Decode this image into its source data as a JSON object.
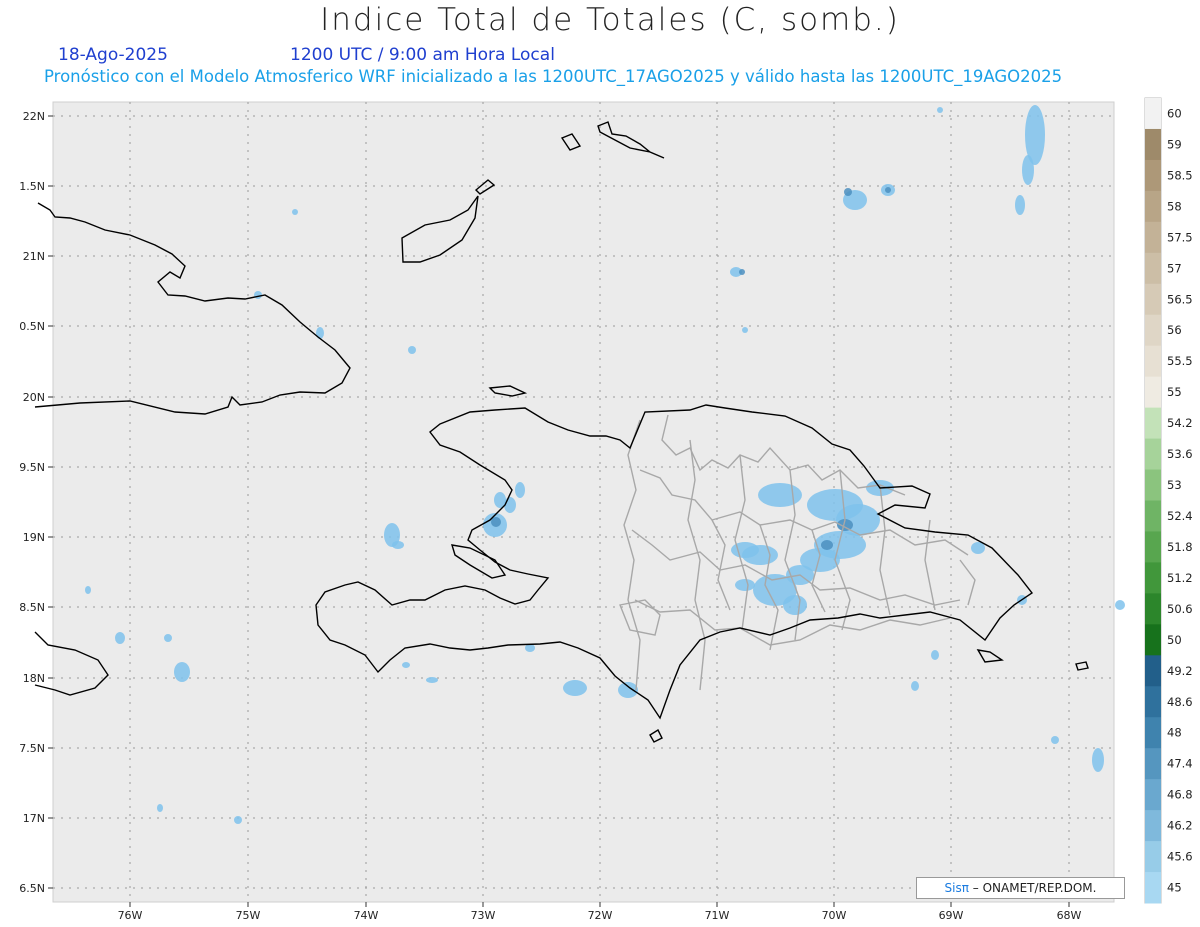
{
  "title": "Indice Total de Totales (C, somb.)",
  "date": "18-Ago-2025",
  "time": "1200 UTC / 9:00 am Hora Local",
  "forecast": "Pronóstico con el Modelo Atmosferico WRF inicializado a las 1200UTC_17AGO2025 y válido hasta las  1200UTC_19AGO2025",
  "credit": {
    "brand": "Sisπ",
    "text": "– ONAMET/REP.DOM."
  },
  "map": {
    "lat_labels": [
      "22N",
      "1.5N",
      "21N",
      "0.5N",
      "20N",
      "9.5N",
      "19N",
      "8.5N",
      "18N",
      "7.5N",
      "17N",
      "6.5N"
    ],
    "lon_labels": [
      "76W",
      "75W",
      "74W",
      "73W",
      "72W",
      "71W",
      "70W",
      "69W",
      "68W"
    ],
    "lat_range": [
      16.5,
      22
    ],
    "lon_range": [
      -76.67,
      -67.62
    ],
    "grid": true,
    "colors": {
      "background": "#ebebeb",
      "coast": "#000000",
      "provinces": "#aaaaaa",
      "shade": "#7fc2ec"
    }
  },
  "colorbar": {
    "labels": [
      "60",
      "59",
      "58.5",
      "58",
      "57.5",
      "57",
      "56.5",
      "56",
      "55.5",
      "55",
      "54.2",
      "53.6",
      "53",
      "52.4",
      "51.8",
      "51.2",
      "50.6",
      "50",
      "49.2",
      "48.6",
      "48",
      "47.4",
      "46.8",
      "46.2",
      "45.6",
      "45"
    ],
    "colors": [
      "#f2f2f2",
      "#9e8a6a",
      "#ad9878",
      "#b8a587",
      "#c3b297",
      "#ccbea6",
      "#d6cab6",
      "#dfd6c6",
      "#e7e0d3",
      "#efebe2",
      "#c3e2b8",
      "#a6d39a",
      "#8bc47e",
      "#6fb465",
      "#58a64f",
      "#41973b",
      "#2c862b",
      "#17721c",
      "#225f8a",
      "#2f719d",
      "#3f83ae",
      "#5596bf",
      "#6aa8cf",
      "#7fb9dc",
      "#97cce8",
      "#a8d8f2"
    ]
  }
}
